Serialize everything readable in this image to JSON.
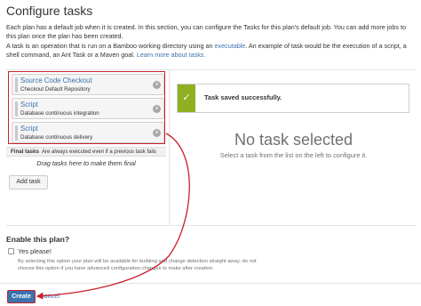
{
  "page": {
    "title": "Configure tasks",
    "intro1": "Each plan has a default job when it is created. In this section, you can configure the Tasks for this plan's default job. You can add more jobs to this plan once the plan has been created.",
    "intro2_prefix": "A task is an operation that is run on a Bamboo working directory using an ",
    "intro2_link1": "executable",
    "intro2_middle": ". An example of task would be the execution of a script, a shell command, an Ant Task or a Maven goal. ",
    "intro2_link2": "Learn more about tasks."
  },
  "tasks": [
    {
      "name": "Source Code Checkout",
      "description": "Checkout Default Repository"
    },
    {
      "name": "Script",
      "description": "Database continuous integration"
    },
    {
      "name": "Script",
      "description": "Database continuous delivery"
    }
  ],
  "final_tasks": {
    "label": "Final tasks",
    "note": "Are always executed even if a previous task fails",
    "drop_hint": "Drag tasks here to make them final"
  },
  "add_task_label": "Add task",
  "remove_glyph": "×",
  "success": {
    "check_glyph": "✓",
    "message": "Task saved successfully."
  },
  "no_task": {
    "title": "No task selected",
    "subtitle": "Select a task from the list on the left to configure it."
  },
  "enable": {
    "title": "Enable this plan?",
    "checkbox_label": "Yes please!",
    "help": "By selecting this option your plan will be available for building and change detection straight away, do not choose this option if you have advanced configuration changes to make after creation."
  },
  "footer": {
    "create_label": "Create",
    "cancel_label": "Cancel"
  },
  "colors": {
    "accent": "#3b73af",
    "highlight": "#c8202a",
    "success": "#8eb021"
  }
}
